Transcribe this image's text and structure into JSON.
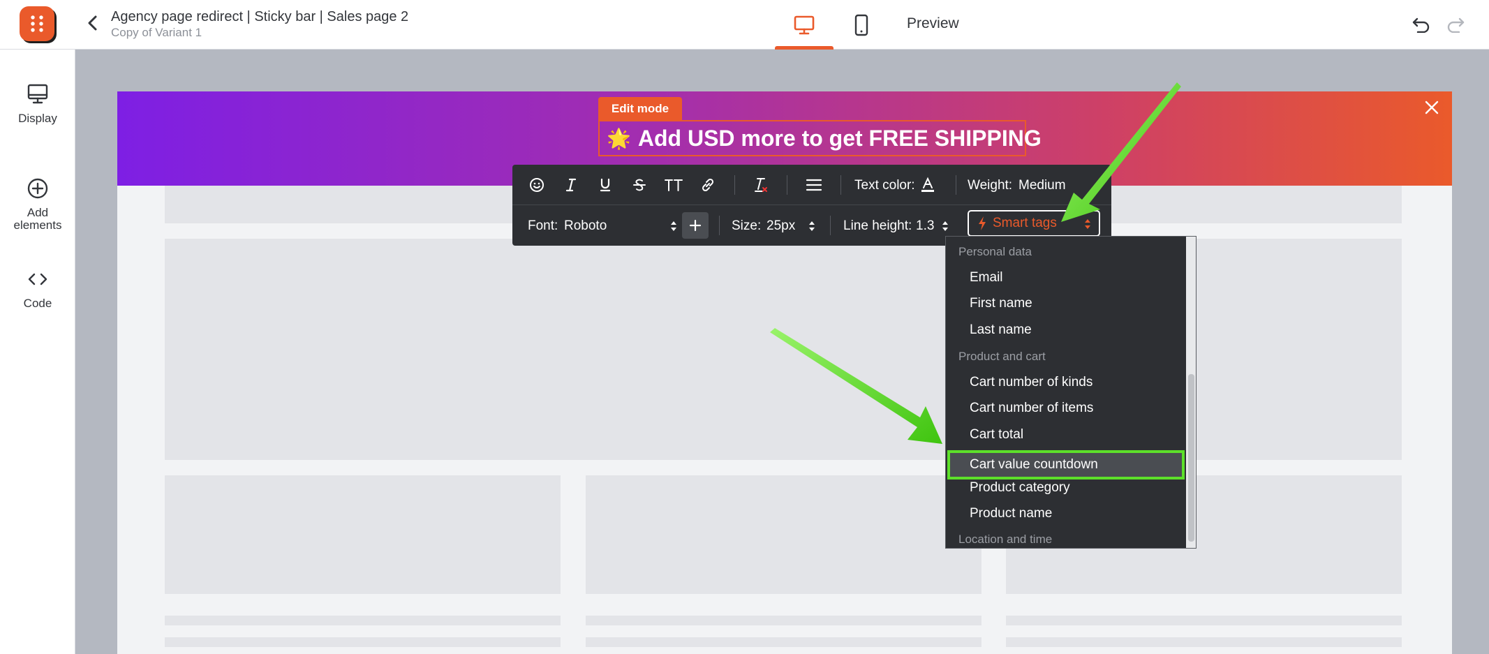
{
  "header": {
    "title": "Agency page redirect | Sticky bar | Sales page 2",
    "subtitle": "Copy of Variant 1",
    "preview_label": "Preview",
    "active_view": "desktop",
    "accent_color": "#ea5a2b"
  },
  "sidebar": {
    "items": [
      {
        "label": "Display",
        "icon": "monitor-icon"
      },
      {
        "label": "Add\nelements",
        "icon": "plus-circle-icon"
      },
      {
        "label": "Code",
        "icon": "code-icon"
      }
    ]
  },
  "editor": {
    "edit_mode_label": "Edit mode",
    "headline_emoji": "🌟",
    "headline_text": "Add USD more to get FREE SHIPPING"
  },
  "toolbar": {
    "text_color_label": "Text color:",
    "weight_label": "Weight:",
    "weight_value": "Medium",
    "font_label": "Font:",
    "font_value": "Roboto",
    "size_label": "Size:",
    "size_value": "25px",
    "line_height_label": "Line height:",
    "line_height_value": "1.3",
    "smart_tags_label": "Smart tags"
  },
  "dropdown": {
    "groups": [
      {
        "heading": "Personal data",
        "options": [
          "Email",
          "First name",
          "Last name"
        ]
      },
      {
        "heading": "Product and cart",
        "options": [
          "Cart number of kinds",
          "Cart number of items",
          "Cart total",
          "Cart value countdown",
          "Product category",
          "Product name"
        ]
      },
      {
        "heading": "Location and time",
        "options": []
      }
    ],
    "selected": "Cart value countdown",
    "highlight_color": "#5de02a"
  }
}
